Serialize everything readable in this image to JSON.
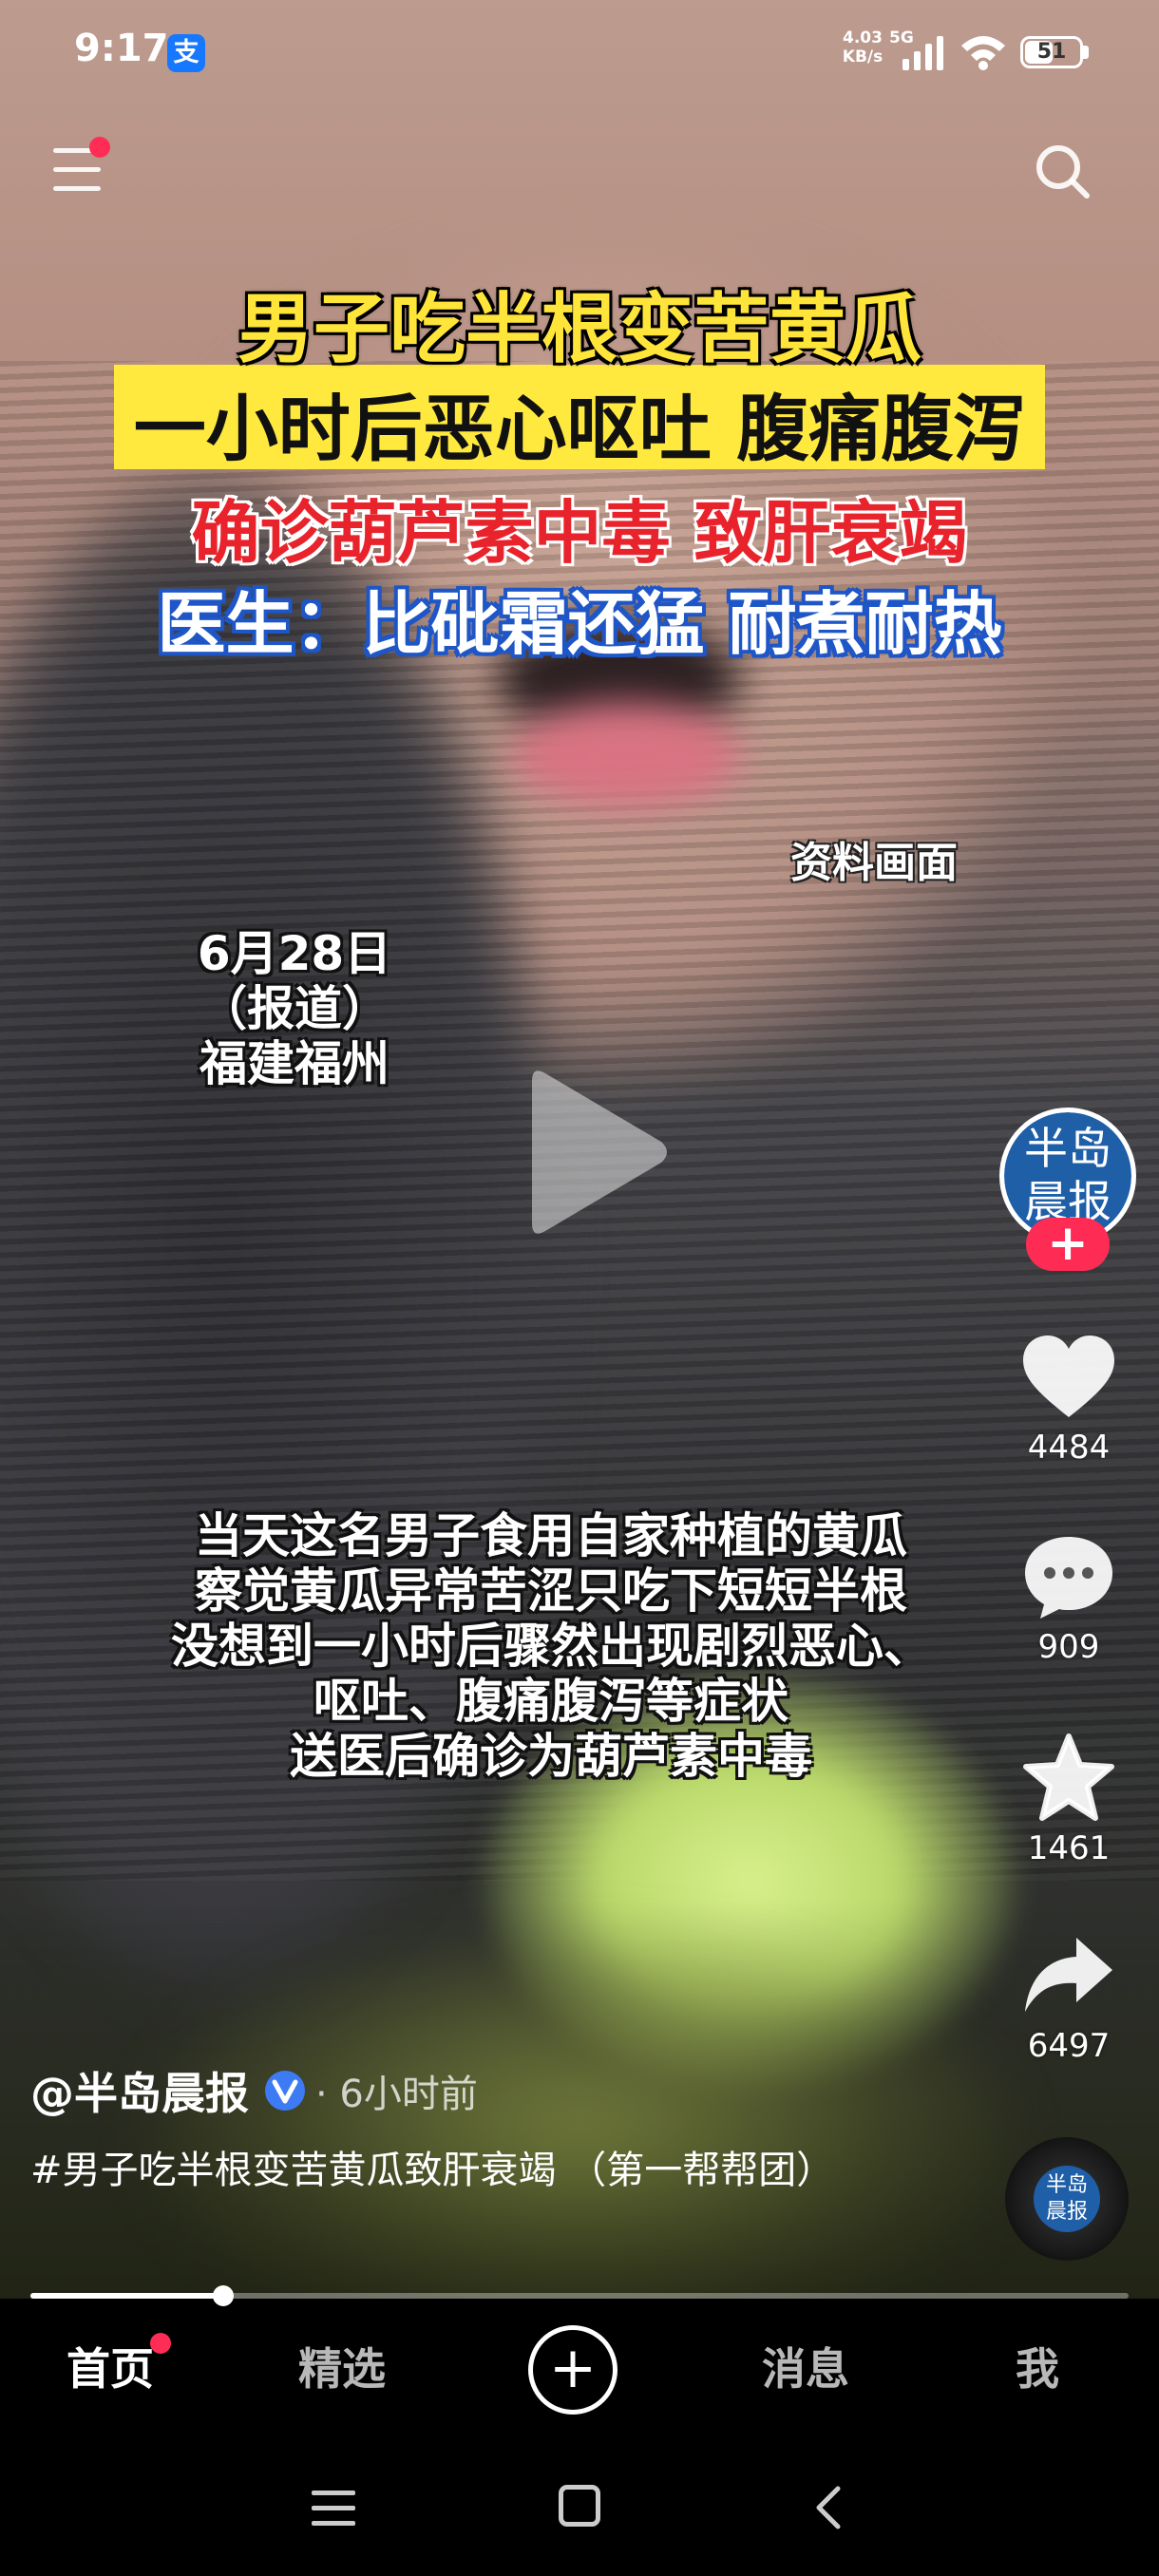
{
  "status_bar": {
    "time": "9:17",
    "app_badge": "支",
    "net_speed_value": "4.03",
    "net_speed_unit": "KB/s",
    "network_type": "5G",
    "battery": "51",
    "battery_level": 0.51
  },
  "video": {
    "headline_1": "男子吃半根变苦黄瓜",
    "headline_2": "一小时后恶心呕吐 腹痛腹泻",
    "headline_3": "确诊葫芦素中毒 致肝衰竭",
    "headline_4": "医生：比砒霜还猛 耐煮耐热",
    "archive_label": "资料画面",
    "date_line_1": "6月28日",
    "date_line_2": "（报道）",
    "date_line_3": "福建福州",
    "subtitles": [
      "当天这名男子食用自家种植的黄瓜",
      "察觉黄瓜异常苦涩只吃下短短半根",
      "没想到一小时后骤然出现剧烈恶心、",
      "呕吐、腹痛腹泻等症状",
      "送医后确诊为葫芦素中毒"
    ]
  },
  "side_actions": {
    "avatar_text_1": "半岛",
    "avatar_text_2": "晨报",
    "follow": "+",
    "likes": "4484",
    "comments": "909",
    "favorites": "1461",
    "shares": "6497",
    "disc_text_1": "半岛",
    "disc_text_2": "晨报"
  },
  "post": {
    "author": "@半岛晨报",
    "time": "· 6小时前",
    "caption": "#男子吃半根变苦黄瓜致肝衰竭 （第一帮帮团）",
    "progress": 0.176
  },
  "bottom_nav": {
    "home": "首页",
    "featured": "精选",
    "create": "+",
    "messages": "消息",
    "me": "我"
  },
  "colors": {
    "accent_red": "#fe2c55",
    "caption_yellow": "#ffe43a",
    "verified_blue": "#3d7bf5"
  }
}
